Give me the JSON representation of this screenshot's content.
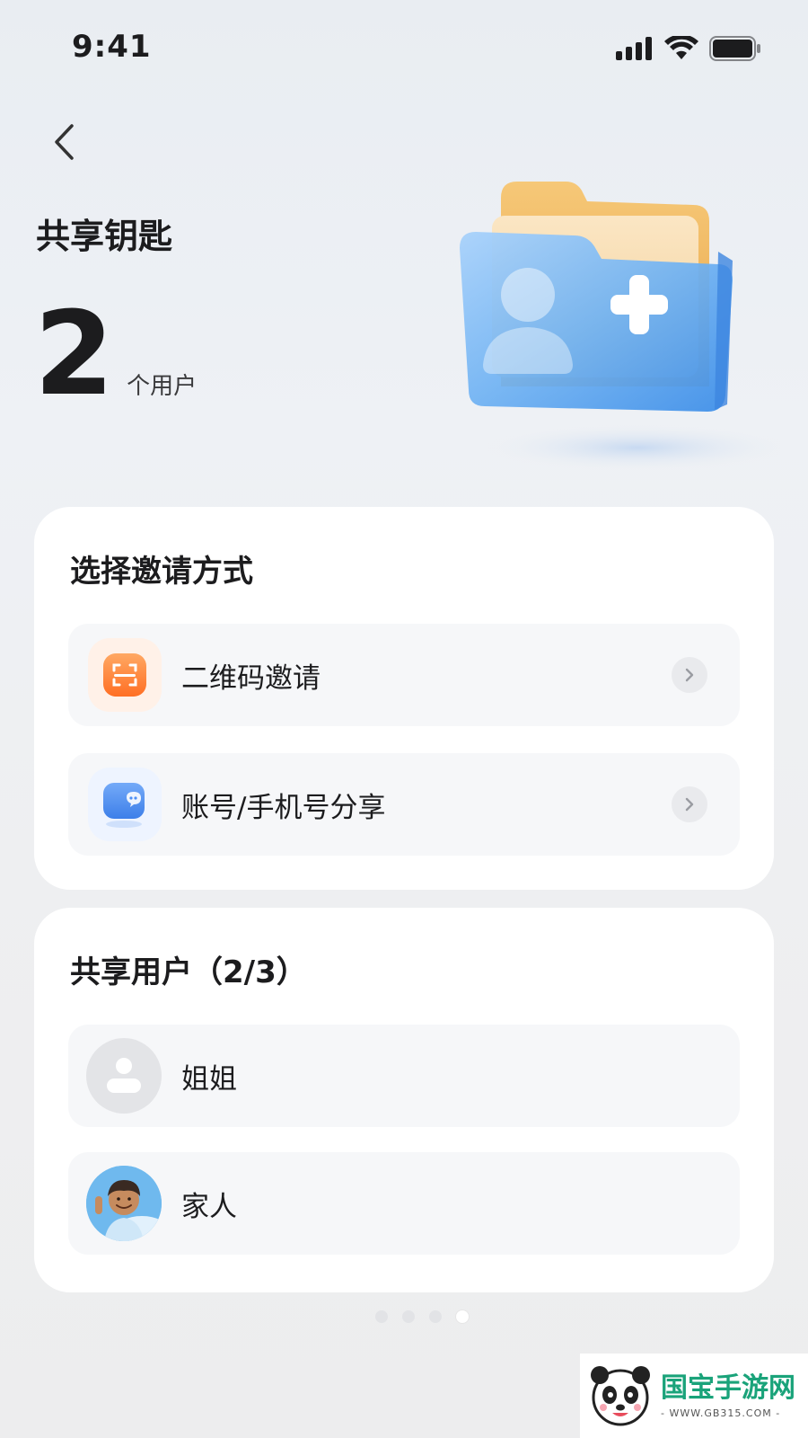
{
  "status_bar": {
    "time": "9:41"
  },
  "header": {
    "title": "共享钥匙"
  },
  "summary": {
    "count": "2",
    "unit": "个用户"
  },
  "invite_card": {
    "title": "选择邀请方式",
    "options": [
      {
        "label": "二维码邀请",
        "icon": "qr-scan-icon"
      },
      {
        "label": "账号/手机号分享",
        "icon": "chat-share-icon"
      }
    ]
  },
  "users_card": {
    "title": "共享用户（2/3）",
    "users": [
      {
        "name": "姐姐",
        "avatar": "default-avatar-icon"
      },
      {
        "name": "家人",
        "avatar": "cartoon-avatar"
      }
    ]
  },
  "pager": {
    "total": 4,
    "active_index": 3
  },
  "watermark": {
    "brand": "国宝手游网",
    "url": "- WWW.GB315.COM -"
  },
  "colors": {
    "qr_icon": "#ff7a2f",
    "share_icon": "#4d8ff5",
    "folder_blue": "#5aa6ee",
    "folder_orange": "#f0b95a"
  }
}
